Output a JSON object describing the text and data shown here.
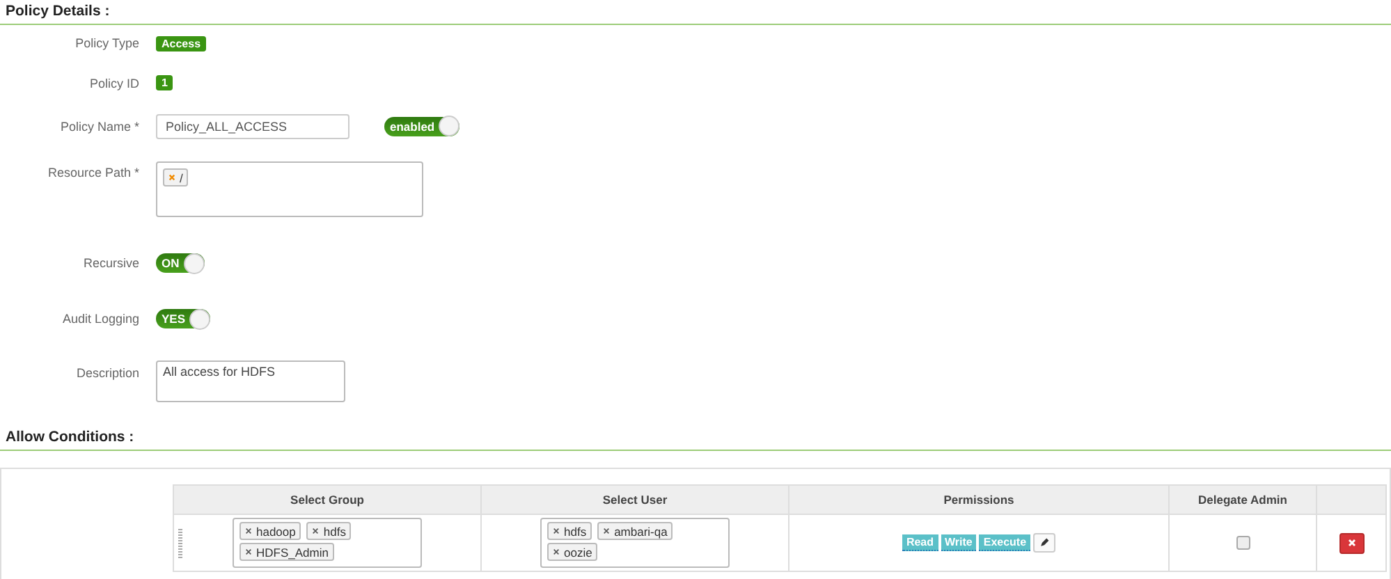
{
  "policy_details": {
    "heading": "Policy Details :",
    "policy_type": {
      "label": "Policy Type",
      "badge": "Access"
    },
    "policy_id": {
      "label": "Policy ID",
      "badge": "1"
    },
    "policy_name": {
      "label": "Policy Name *",
      "value": "Policy_ALL_ACCESS",
      "toggle": {
        "label": "enabled",
        "on": true
      }
    },
    "resource_path": {
      "label": "Resource Path *",
      "tags": [
        "/"
      ]
    },
    "recursive": {
      "label": "Recursive",
      "toggle": {
        "label": "ON",
        "on": true
      }
    },
    "audit_logging": {
      "label": "Audit Logging",
      "toggle": {
        "label": "YES",
        "on": true
      }
    },
    "description": {
      "label": "Description",
      "value": "All access for HDFS"
    }
  },
  "allow_conditions": {
    "heading": "Allow Conditions :",
    "columns": [
      "Select Group",
      "Select User",
      "Permissions",
      "Delegate Admin"
    ],
    "rows": [
      {
        "groups": [
          "hadoop",
          "hdfs",
          "HDFS_Admin"
        ],
        "users": [
          "hdfs",
          "ambari-qa",
          "oozie"
        ],
        "permissions": [
          "Read",
          "Write",
          "Execute"
        ],
        "delegate_admin": false
      }
    ]
  }
}
